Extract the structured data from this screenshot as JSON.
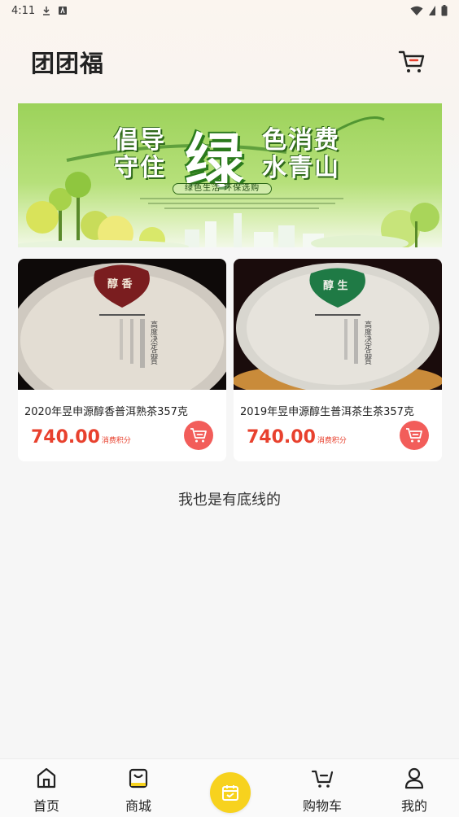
{
  "status": {
    "time": "4:11"
  },
  "header": {
    "title": "团团福",
    "cart_icon": "cart-icon"
  },
  "banner": {
    "line1": "倡导",
    "line2": "守住",
    "big": "绿",
    "line3": "色消费",
    "line4": "水青山",
    "sub": "绿色生活  环保选购"
  },
  "products": [
    {
      "name": "2020年昱申源醇香普洱熟茶357克",
      "price": "740.00",
      "unit": "消费积分",
      "seal": "醇 香",
      "wrapper_text": "高度决定品質"
    },
    {
      "name": "2019年昱申源醇生普洱茶生茶357克",
      "price": "740.00",
      "unit": "消费积分",
      "seal": "醇 生",
      "wrapper_text": "高度决定品質"
    }
  ],
  "footer_note": "我也是有底线的",
  "tabs": [
    {
      "label": "首页",
      "icon": "home-icon"
    },
    {
      "label": "商城",
      "icon": "shop-bag-icon"
    },
    {
      "label": "",
      "icon": "calendar-icon"
    },
    {
      "label": "购物车",
      "icon": "cart-icon"
    },
    {
      "label": "我的",
      "icon": "user-icon"
    }
  ],
  "colors": {
    "accent": "#e8412e",
    "cart_button": "#f25d5a",
    "center_tab": "#f7d21e"
  }
}
